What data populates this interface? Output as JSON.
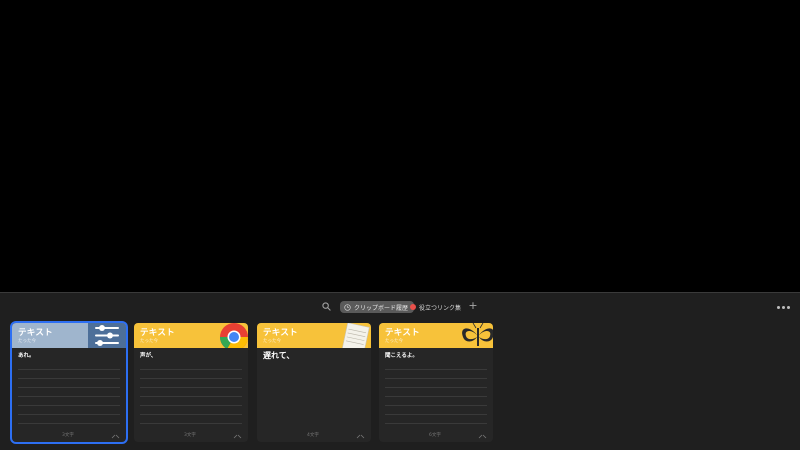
{
  "toolbar": {
    "history_label": "クリップボード履歴",
    "list_label": "役立つリンク集",
    "plus_label": "+"
  },
  "cards": [
    {
      "title": "テキスト",
      "subtitle": "たった今",
      "body": "あれ。",
      "count": "3文字",
      "header_color": "#9fb5cd",
      "app_icon": "sliders-icon",
      "selected": true
    },
    {
      "title": "テキスト",
      "subtitle": "たった今",
      "body": "声が、",
      "count": "3文字",
      "header_color": "#f7c23a",
      "app_icon": "chrome-icon",
      "selected": false
    },
    {
      "title": "テキスト",
      "subtitle": "たった今",
      "body": "遅れて、",
      "count": "4文字",
      "header_color": "#f7c23a",
      "app_icon": "notes-icon",
      "selected": false
    },
    {
      "title": "テキスト",
      "subtitle": "たった今",
      "body": "聞こえるよ。",
      "count": "6文字",
      "header_color": "#f7c23a",
      "app_icon": "butterfly-icon",
      "selected": false
    }
  ],
  "colors": {
    "selection": "#2d6ff3",
    "panel_bg": "#1f1f1f",
    "card_bg": "#262626"
  }
}
